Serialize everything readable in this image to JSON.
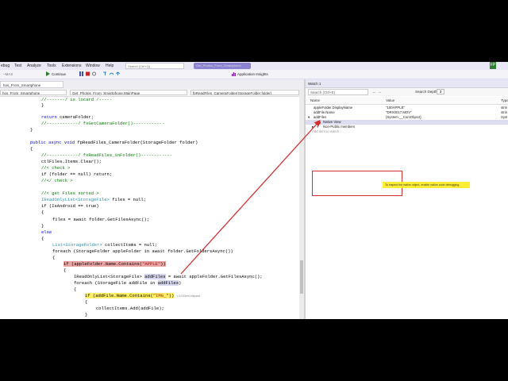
{
  "menubar": {
    "items": [
      "ebug",
      "Test",
      "Analyze",
      "Tools",
      "Extensions",
      "Window",
      "Help"
    ],
    "search_placeholder": "Search (Ctrl+Q)",
    "title_pill": "Get_Photos_From_Smartphone",
    "avatar": "FP"
  },
  "toolbar": {
    "config_value": "~MAX",
    "continue_label": "Continue",
    "insights_label": "Application Insights"
  },
  "tabs": {
    "tab1": "hos_From_Smartphone",
    "tab2": "Get_Photos_From_Smartphone.MainPage",
    "tab3": "fpReadFiles_CameraFolder(StorageFolder folder)"
  },
  "code": {
    "line1": "//-------/ is locard /-----",
    "line2": "}",
    "line3": "return cameraFolder;",
    "line4": "//------------/ fxGetCameraFolder()------------",
    "line5": "}",
    "line6_kw": "public async void ",
    "line6_rest": "fpReadFiles_CameraFolder(StorageFolder folder)",
    "line7": "{",
    "line8": "//------------/ fxReadFiles_inFolder()------------",
    "line9": "ctlFiles.Items.Clear();",
    "line10": "//< check >",
    "line11": "if (folder == null) return;",
    "line12": "//</ check >",
    "line13": "//< get Files sorted >",
    "line14_type": "IReadOnlyList<StorageFile>",
    "line14_rest": " files = null;",
    "line15": "if (IsAndroid == true)",
    "line16": "{",
    "line17": "files = await folder.GetFilesAsync();",
    "line18": "}",
    "line19": "else",
    "line20": "{",
    "line21_type": "List<StorageFolder>",
    "line21_rest": " collectItems = null;",
    "line22": "foreach (StorageFolder appleFolder in await folder.GetFoldersAsync())",
    "line23": "{",
    "line24_a": "if (appleFolder.Name.Contains(",
    "line24_str": "\"APPLE\"",
    "line24_b": "))",
    "line25": "{",
    "line26_a": "IReadOnlyList<StorageFile> ",
    "line26_var": "addFiles",
    "line26_b": " = await appleFolder.GetFilesAsync();",
    "line27_a": "foreach (StorageFile addFile in ",
    "line27_var": "addFiles",
    "line27_b": ")",
    "line28": "{",
    "line29_a": "if (addFile.Name.Contains(",
    "line29_str": "\"IMG_\"",
    "line29_b": "))",
    "line29_elapsed": "≤ 6,013ms elapsed",
    "line30": "{",
    "line31": "collectItems.Add(addFile);",
    "line32": "}"
  },
  "watch": {
    "title": "Watch 1",
    "search_placeholder": "Search (Ctrl+E)",
    "depth_label": "Search Depth:",
    "depth_value": "3",
    "col_name": "Name",
    "col_value": "Value",
    "col_type": "Type",
    "rows": [
      {
        "name": "appleFolder.DisplayName",
        "value": "\"100APPLE\"",
        "type": "strin"
      },
      {
        "name": "addFile.Name",
        "value": "\"DRX0017.MOV\"",
        "type": "strin"
      },
      {
        "name": "addFiles",
        "value": "{System.__ComObject}",
        "type": "Syst"
      },
      {
        "name": "Native View",
        "value": "",
        "type": ""
      },
      {
        "name": "Non-Public members",
        "value": "",
        "type": ""
      }
    ],
    "add_item": "Add item to watch",
    "tooltip": "To inspect the native object, enable native code debugging."
  }
}
